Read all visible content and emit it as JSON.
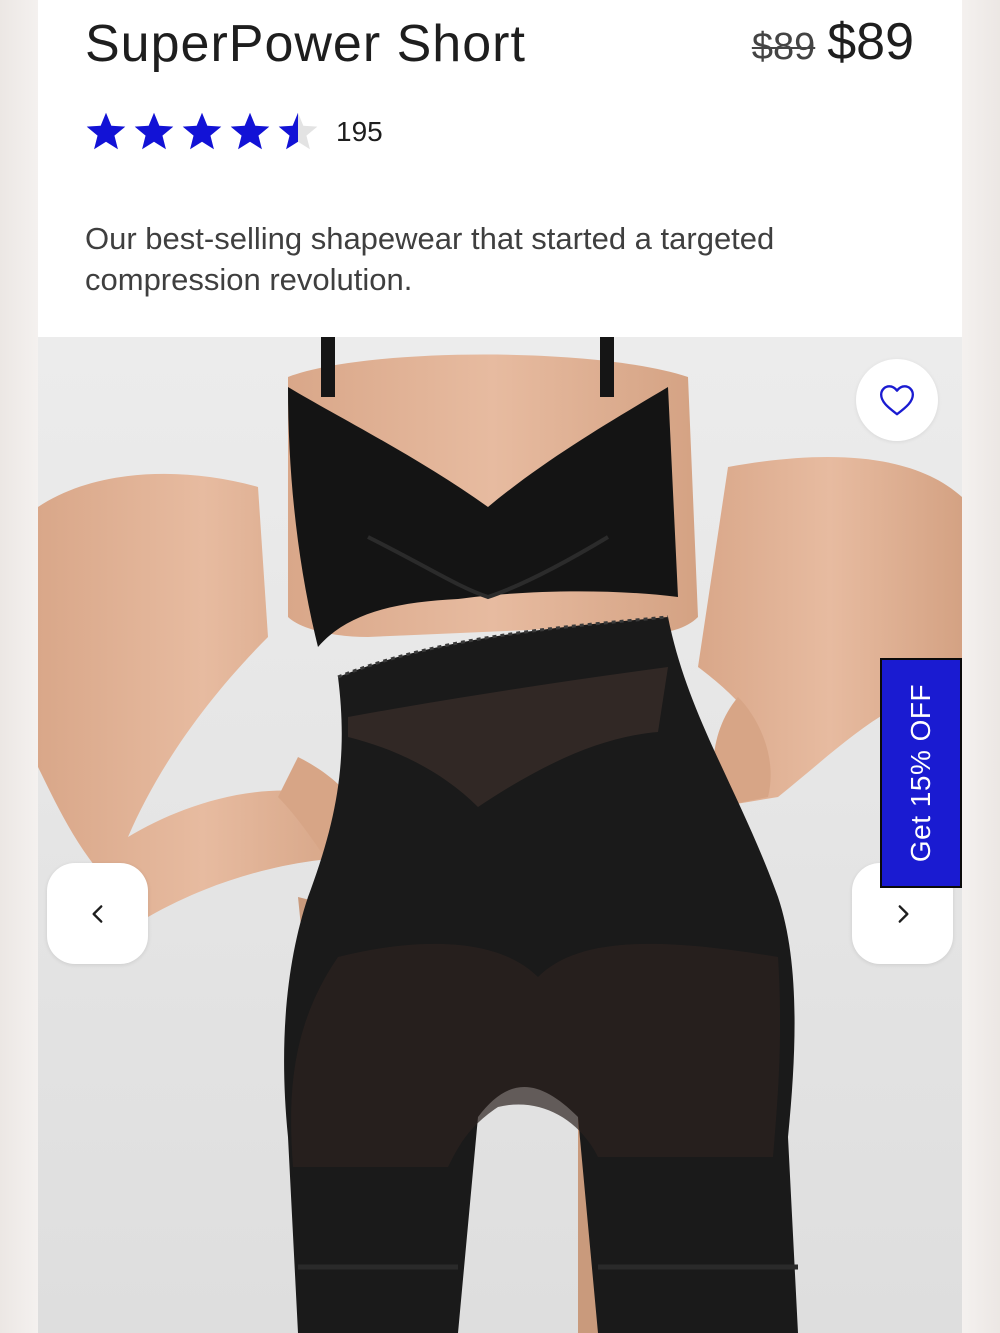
{
  "product": {
    "title": "SuperPower Short",
    "price_original": "$89",
    "price_current": "$89",
    "rating": 4.5,
    "rating_max": 5,
    "review_count": "195",
    "description": "Our best-selling shapewear that started a targeted compression revolution."
  },
  "gallery": {
    "wishlist_icon": "heart-outline-icon",
    "prev_icon": "chevron-left-icon",
    "next_icon": "chevron-right-icon"
  },
  "promo": {
    "label": "Get 15% OFF"
  },
  "colors": {
    "star_fill": "#1212d6",
    "star_empty": "#e3e3e3",
    "promo_bg": "#1a1bd1",
    "text_primary": "#1e1e1e",
    "text_secondary": "#3f3f3f"
  }
}
